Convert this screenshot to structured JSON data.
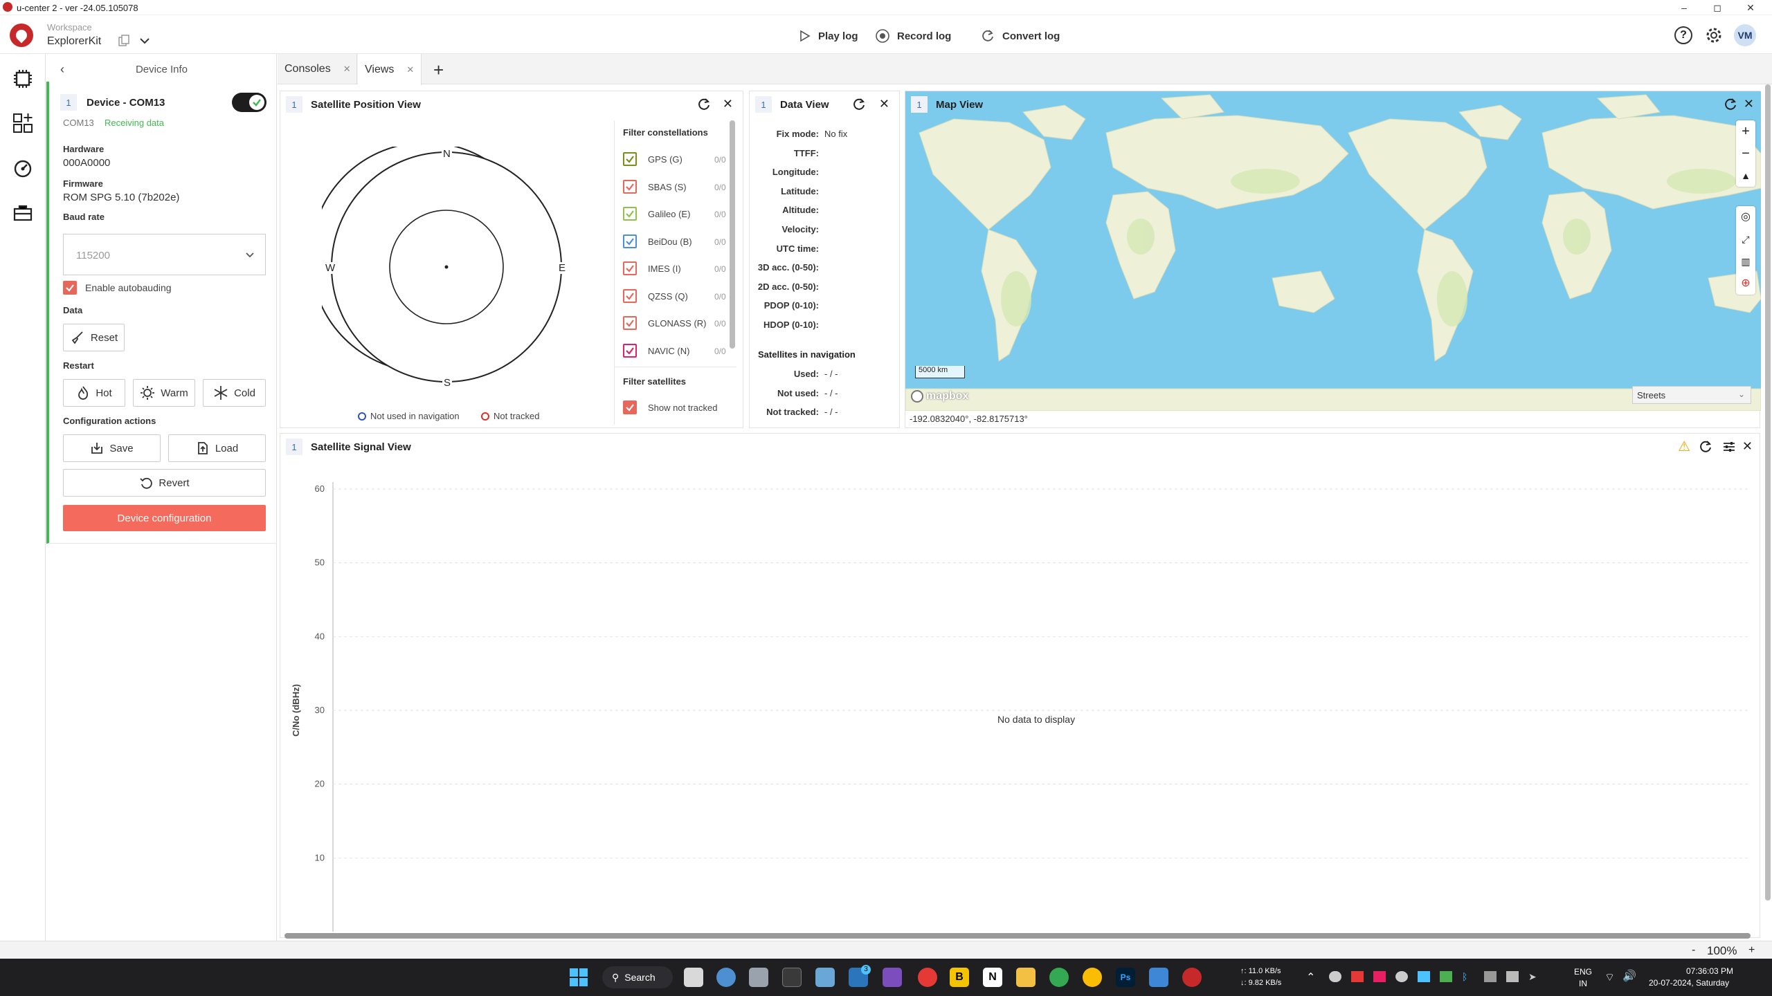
{
  "window": {
    "title": "u-center 2 - ver -24.05.105078"
  },
  "appbar": {
    "workspace_label": "Workspace",
    "workspace_name": "ExplorerKit",
    "play_log": "Play log",
    "record_log": "Record log",
    "convert_log": "Convert log",
    "avatar": "VM"
  },
  "device_panel": {
    "title": "Device Info",
    "badge": "1",
    "device_name": "Device - COM13",
    "port": "COM13",
    "status": "Receiving data",
    "hardware_label": "Hardware",
    "hardware_value": "000A0000",
    "firmware_label": "Firmware",
    "firmware_value": "ROM SPG 5.10 (7b202e)",
    "baud_label": "Baud rate",
    "baud_value": "115200",
    "autobaud_label": "Enable autobauding",
    "data_label": "Data",
    "reset": "Reset",
    "restart_label": "Restart",
    "hot": "Hot",
    "warm": "Warm",
    "cold": "Cold",
    "config_label": "Configuration actions",
    "save": "Save",
    "load": "Load",
    "revert": "Revert",
    "device_config": "Device configuration"
  },
  "tabs": [
    {
      "label": "Consoles"
    },
    {
      "label": "Views"
    }
  ],
  "sat_pos": {
    "badge": "1",
    "title": "Satellite Position View",
    "north": "N",
    "south": "S",
    "east": "E",
    "west": "W",
    "legend_not_used": "Not used in navigation",
    "legend_not_tracked": "Not tracked",
    "filter_const_title": "Filter constellations",
    "constellations": [
      {
        "label": "GPS (G)",
        "count": "0/0",
        "color": "#7a8f1a"
      },
      {
        "label": "SBAS (S)",
        "count": "0/0",
        "color": "#e8675b"
      },
      {
        "label": "Galileo (E)",
        "count": "0/0",
        "color": "#8fc24a"
      },
      {
        "label": "BeiDou (B)",
        "count": "0/0",
        "color": "#4a90d9"
      },
      {
        "label": "IMES (I)",
        "count": "0/0",
        "color": "#e8675b"
      },
      {
        "label": "QZSS (Q)",
        "count": "0/0",
        "color": "#e8675b"
      },
      {
        "label": "GLONASS (R)",
        "count": "0/0",
        "color": "#e8675b"
      },
      {
        "label": "NAVIC (N)",
        "count": "0/0",
        "color": "#e0206b"
      }
    ],
    "filter_sat_title": "Filter satellites",
    "show_not_tracked": "Show not tracked"
  },
  "data_view": {
    "badge": "1",
    "title": "Data View",
    "rows": [
      {
        "label": "Fix mode:",
        "value": "No fix"
      },
      {
        "label": "TTFF:",
        "value": ""
      },
      {
        "label": "Longitude:",
        "value": ""
      },
      {
        "label": "Latitude:",
        "value": ""
      },
      {
        "label": "Altitude:",
        "value": ""
      },
      {
        "label": "Velocity:",
        "value": ""
      },
      {
        "label": "UTC time:",
        "value": ""
      },
      {
        "label": "3D acc. (0-50):",
        "value": ""
      },
      {
        "label": "2D acc. (0-50):",
        "value": ""
      },
      {
        "label": "PDOP (0-10):",
        "value": ""
      },
      {
        "label": "HDOP (0-10):",
        "value": ""
      }
    ],
    "sats_title": "Satellites in navigation",
    "sat_rows": [
      {
        "label": "Used:",
        "value": "- / -"
      },
      {
        "label": "Not used:",
        "value": "- / -"
      },
      {
        "label": "Not tracked:",
        "value": "- / -"
      }
    ]
  },
  "map_view": {
    "badge": "1",
    "title": "Map View",
    "scale": "5000 km",
    "brand": "mapbox",
    "style": "Streets",
    "coords": "-192.0832040°, -82.8175713°",
    "colors": {
      "ocean": "#7ccbed",
      "land": "#eef0d8",
      "green": "#d4e8b4"
    }
  },
  "signal_view": {
    "badge": "1",
    "title": "Satellite Signal View",
    "no_data": "No data to display"
  },
  "chart_data": {
    "type": "bar",
    "title": "Satellite Signal View",
    "ylabel": "C/No (dBHz)",
    "xlabel": "",
    "ylim": [
      0,
      60
    ],
    "yticks": [
      10,
      20,
      30,
      40,
      50,
      60
    ],
    "categories": [],
    "values": [],
    "grid": true
  },
  "statusbar": {
    "zoom": "100%",
    "minus": "-",
    "plus": "+"
  },
  "taskbar": {
    "search": "Search",
    "net_up": "↑: 11.0 KB/s",
    "net_down": "↓: 9.82 KB/s",
    "lang": "ENG",
    "region": "IN",
    "time": "07:36:03 PM",
    "date": "20-07-2024, Saturday",
    "steam_badge": "3"
  }
}
